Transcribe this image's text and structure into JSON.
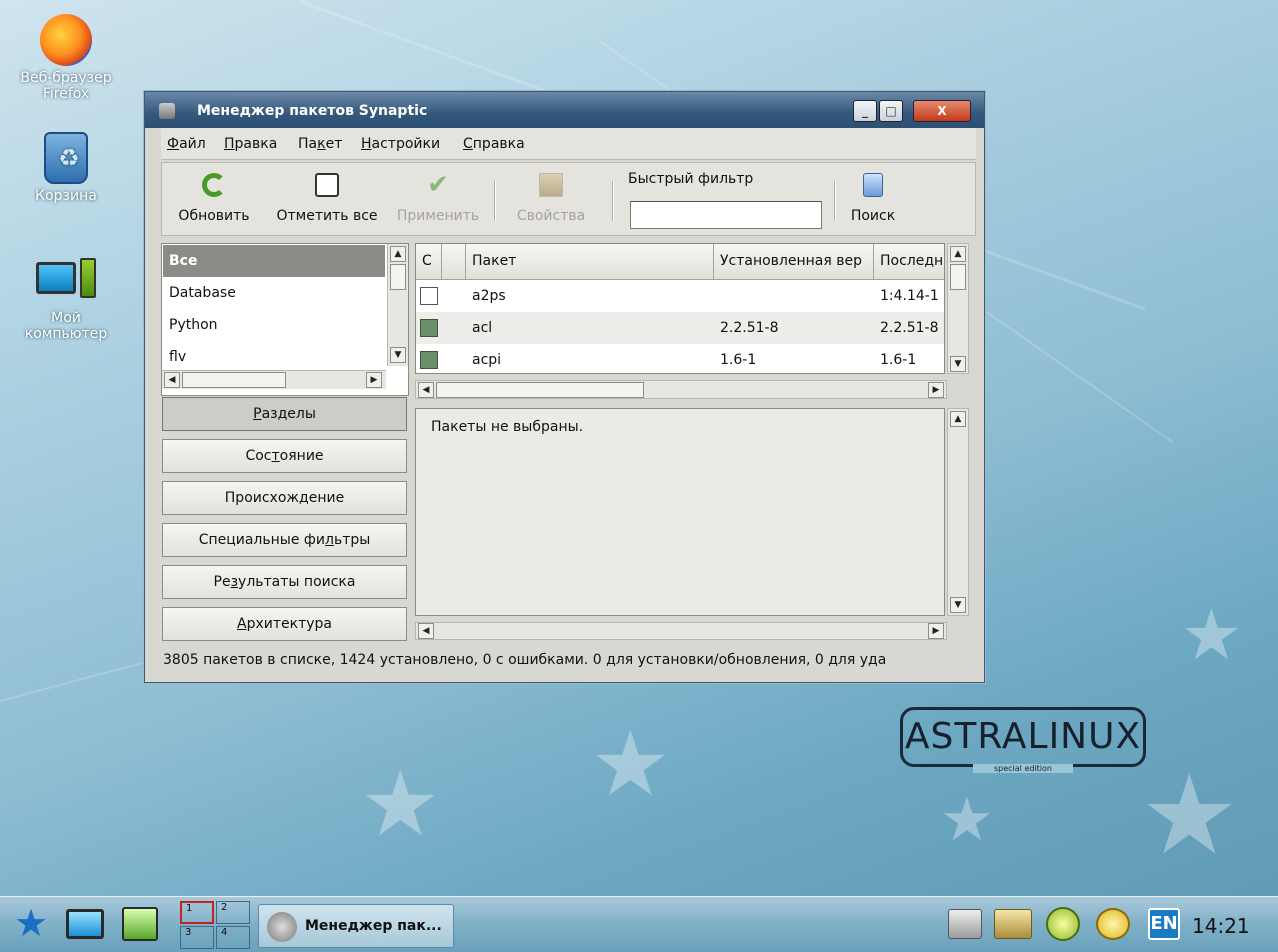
{
  "desktop": {
    "icons": [
      {
        "line1": "Веб-браузер",
        "line2": "Firefox"
      },
      {
        "line1": "Корзина",
        "line2": ""
      },
      {
        "line1": "Мой",
        "line2": "компьютер"
      }
    ],
    "logo": {
      "name": "ASTRALINUX",
      "sub": "special edition"
    }
  },
  "window": {
    "title": "Менеджер пакетов Synaptic",
    "controls": {
      "minimize": "_",
      "maximize": "□",
      "close": "X"
    },
    "menu": [
      {
        "pre": "",
        "key": "Ф",
        "post": "айл"
      },
      {
        "pre": "",
        "key": "П",
        "post": "равка"
      },
      {
        "pre": "Па",
        "key": "к",
        "post": "ет"
      },
      {
        "pre": "",
        "key": "Н",
        "post": "астройки"
      },
      {
        "pre": "",
        "key": "С",
        "post": "правка"
      }
    ],
    "toolbar": {
      "refresh": "Обновить",
      "mark_all": "Отметить все",
      "apply": "Применить",
      "properties": "Свойства",
      "quick_filter_label": "Быстрый фильтр",
      "quick_filter_value": "",
      "search": "Поиск"
    },
    "sections": [
      "Все",
      "Database",
      "Python",
      "flv"
    ],
    "filter_buttons": [
      {
        "pre": "",
        "key": "Р",
        "post": "азделы"
      },
      {
        "pre": "Сос",
        "key": "т",
        "post": "ояние"
      },
      {
        "pre": "Происхож",
        "key": "д",
        "post": "ение"
      },
      {
        "pre": "Специальные фи",
        "key": "л",
        "post": "ьтры"
      },
      {
        "pre": "Ре",
        "key": "з",
        "post": "ультаты поиска"
      },
      {
        "pre": "",
        "key": "А",
        "post": "рхитектура"
      }
    ],
    "table": {
      "columns": [
        "С",
        "",
        "Пакет",
        "Установленная вер",
        "Последн"
      ],
      "rows": [
        {
          "status": "not-installed",
          "package": "a2ps",
          "installed": "",
          "latest": "1:4.14-1"
        },
        {
          "status": "installed",
          "package": "acl",
          "installed": "2.2.51-8",
          "latest": "2.2.51-8"
        },
        {
          "status": "installed",
          "package": "acpi",
          "installed": "1.6-1",
          "latest": "1.6-1"
        }
      ]
    },
    "description": "Пакеты не выбраны.",
    "status": "3805 пакетов в списке, 1424 установлено, 0 с ошибками. 0 для установки/обновления, 0 для уда"
  },
  "taskbar": {
    "pager": [
      "1",
      "2",
      "3",
      "4"
    ],
    "task_label": "Менеджер пак...",
    "layout": "EN",
    "clock": "14:21"
  },
  "colors": {
    "titlebar": "#34587c",
    "selection": "#8c8b86",
    "installed_box": "#6b8e6b",
    "taskbar": "#7fb0c8"
  }
}
